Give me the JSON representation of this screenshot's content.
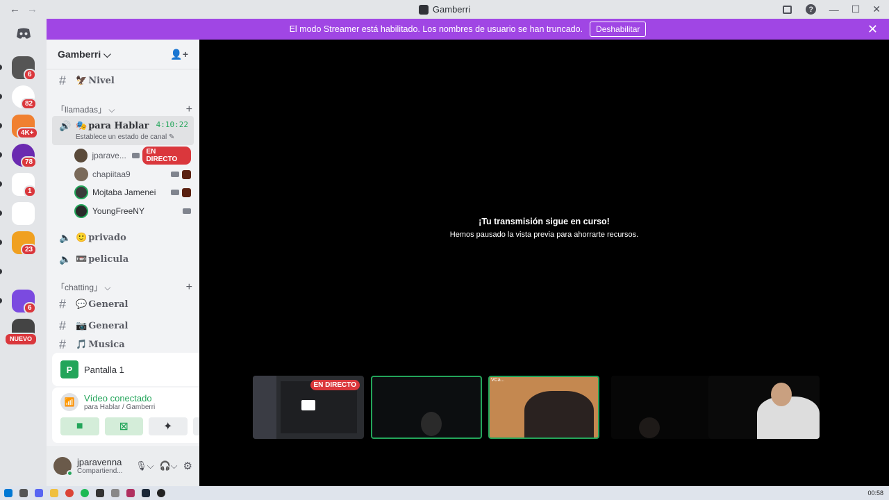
{
  "window": {
    "title": "Gamberri",
    "back": "←",
    "forward": "→"
  },
  "banner": {
    "text": "El modo Streamer está habilitado. Los nombres de usuario se han truncado.",
    "button": "Deshabilitar",
    "close": "✕"
  },
  "guilds": {
    "badges": [
      "6",
      "82",
      "4K+",
      "78",
      "1",
      "23",
      "6"
    ],
    "new_label": "NUEVO"
  },
  "server": {
    "name": "Gamberri ⌵"
  },
  "channels": {
    "nivel": "Nivel",
    "cat_llamadas": "「llamadas」 ⌵",
    "voice_active": {
      "name": "para Hablar",
      "timer": "4:10:22",
      "status": "Establece un estado de canal ✎"
    },
    "members": [
      {
        "name": "jparave...",
        "live": "EN DIRECTO"
      },
      {
        "name": "chapiitaa9"
      },
      {
        "name": "Mojtaba Jamenei"
      },
      {
        "name": "YoungFreeNY"
      }
    ],
    "privado": "privado",
    "pelicula": "pelicula",
    "cat_chatting": "「chatting」 ⌵",
    "general1": "General",
    "general2": "General",
    "musica": "Musica"
  },
  "screen_panel": {
    "title": "Pantalla 1"
  },
  "voice_panel": {
    "status": "Vídeo conectado",
    "channel": "para Hablar / Gamberri"
  },
  "user": {
    "name": "jparavenna",
    "status": "Compartiend..."
  },
  "stage": {
    "title": "¡Tu transmisión sigue en curso!",
    "subtitle": "Hemos pausado la vista previa para ahorrarte recursos.",
    "live_label": "EN DIRECTO",
    "tile3_label": "VCa..."
  },
  "taskbar": {
    "time": "00:58"
  }
}
